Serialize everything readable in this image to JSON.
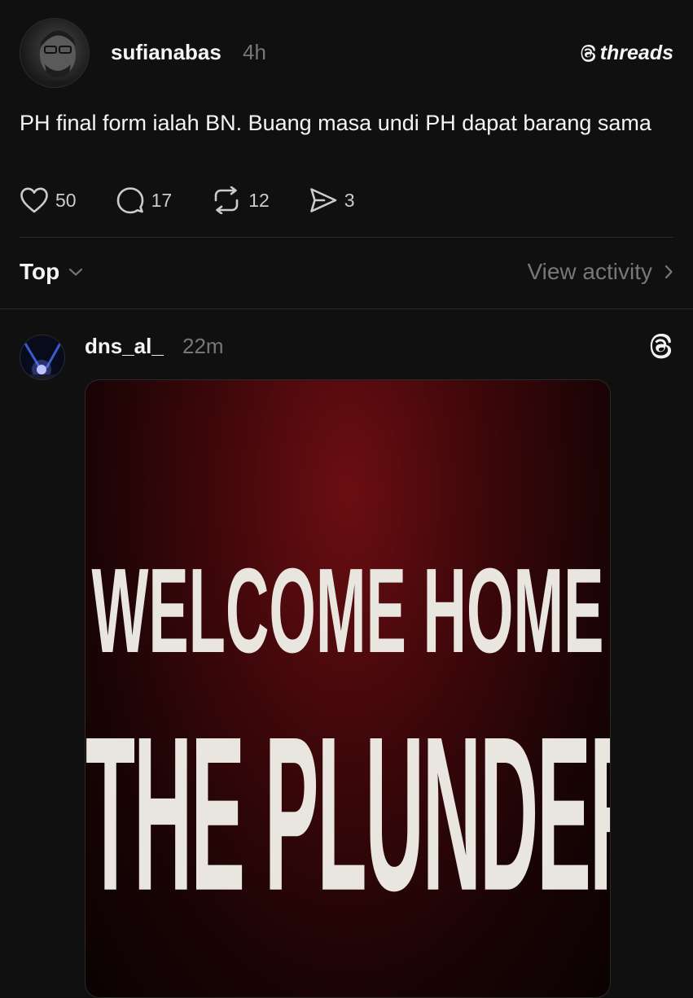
{
  "post": {
    "username": "sufianabas",
    "time": "4h",
    "brand": "threads",
    "text": "PH final form ialah BN. Buang masa undi PH dapat barang sama",
    "likes": "50",
    "replies": "17",
    "reposts": "12",
    "shares": "3"
  },
  "sort": {
    "label": "Top",
    "view_activity": "View activity"
  },
  "reply": {
    "username": "dns_al_",
    "time": "22m",
    "media": {
      "line1": "WELCOME HOME",
      "line2": "THE PLUNDERER"
    }
  },
  "icons": {
    "like": "heart-icon",
    "reply": "comment-icon",
    "repost": "repost-icon",
    "share": "send-icon",
    "brand": "threads-logo-icon",
    "chevron_down": "chevron-down-icon",
    "chevron_right": "chevron-right-icon"
  },
  "colors": {
    "background": "#101010",
    "text": "#f3f5f7",
    "muted": "#777777",
    "divider": "#2b2b2b",
    "poster_red": "#6b0e12"
  }
}
